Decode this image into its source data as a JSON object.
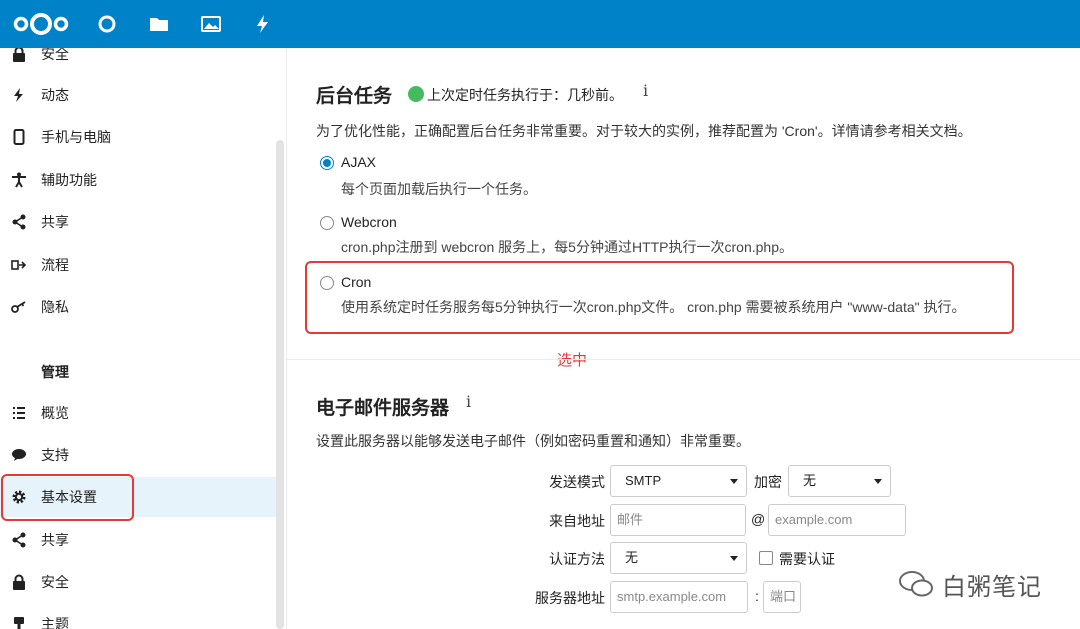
{
  "brand": {
    "accent": "#0082c9",
    "success": "#46ba61",
    "annotation": "#e53935"
  },
  "topbar": {
    "apps": [
      {
        "icon": "dashboard-circle-icon"
      },
      {
        "icon": "files-folder-icon"
      },
      {
        "icon": "photos-image-icon"
      },
      {
        "icon": "activity-bolt-icon"
      }
    ]
  },
  "sidebar": {
    "personal_items": [
      {
        "label": "安全",
        "icon": "lock-icon"
      },
      {
        "label": "动态",
        "icon": "bolt-icon"
      },
      {
        "label": "手机与电脑",
        "icon": "phone-icon"
      },
      {
        "label": "辅助功能",
        "icon": "accessibility-icon"
      },
      {
        "label": "共享",
        "icon": "share-icon"
      },
      {
        "label": "流程",
        "icon": "flow-icon"
      },
      {
        "label": "隐私",
        "icon": "key-icon"
      }
    ],
    "admin_heading": "管理",
    "admin_items": [
      {
        "label": "概览",
        "icon": "list-icon"
      },
      {
        "label": "支持",
        "icon": "chat-bubble-icon"
      },
      {
        "label": "基本设置",
        "icon": "gear-icon",
        "active": true
      },
      {
        "label": "共享",
        "icon": "share-icon"
      },
      {
        "label": "安全",
        "icon": "lock-icon"
      },
      {
        "label": "主题",
        "icon": "brush-icon"
      }
    ]
  },
  "background_jobs": {
    "title": "后台任务",
    "status": "上次定时任务执行于：几秒前。",
    "info": "i",
    "description": "为了优化性能，正确配置后台任务非常重要。对于较大的实例，推荐配置为 'Cron'。详情请参考相关文档。",
    "options": [
      {
        "label": "AJAX",
        "description": "每个页面加载后执行一个任务。",
        "checked": true
      },
      {
        "label": "Webcron",
        "description": "cron.php注册到 webcron 服务上，每5分钟通过HTTP执行一次cron.php。",
        "checked": false
      },
      {
        "label": "Cron",
        "description": "使用系统定时任务服务每5分钟执行一次cron.php文件。 cron.php 需要被系统用户 \"www-data\" 执行。",
        "checked": false
      }
    ],
    "annotation": "选中"
  },
  "email_server": {
    "title": "电子邮件服务器",
    "info": "i",
    "description": "设置此服务器以能够发送电子邮件（例如密码重置和通知）非常重要。",
    "send_mode_label": "发送模式",
    "send_mode_value": "SMTP",
    "encryption_label": "加密",
    "encryption_value": "无",
    "from_label": "来自地址",
    "from_placeholder": "邮件",
    "at": "@",
    "domain_placeholder": "example.com",
    "auth_method_label": "认证方法",
    "auth_method_value": "无",
    "auth_required_label": "需要认证",
    "server_label": "服务器地址",
    "server_placeholder": "smtp.example.com",
    "colon": ":",
    "port_placeholder": "端口"
  },
  "watermark": {
    "text": "白粥笔记"
  }
}
